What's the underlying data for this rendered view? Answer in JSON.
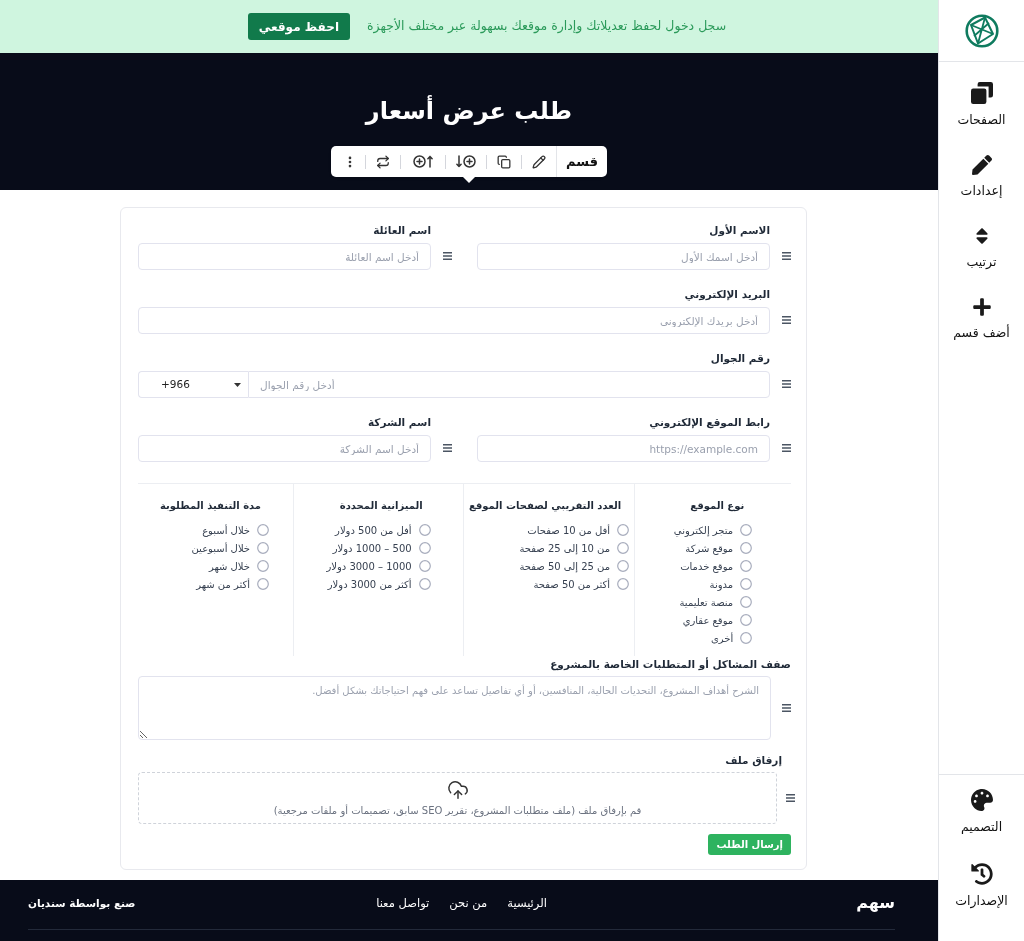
{
  "banner": {
    "message": "سجل دخول لحفظ تعديلاتك وإدارة موقعك بسهولة عبر مختلف الأجهزة",
    "button": "احفظ موقعي"
  },
  "header": {
    "title": "طلب عرض أسعار",
    "toolbar_label": "قسم"
  },
  "form": {
    "rows": [
      {
        "fields": [
          {
            "kind": "text",
            "label": "الاسم الأول",
            "placeholder": "أدخل اسمك الأول"
          },
          {
            "kind": "text",
            "label": "اسم العائلة",
            "placeholder": "أدخل اسم العائلة"
          }
        ]
      },
      {
        "fields": [
          {
            "kind": "text",
            "label": "البريد الإلكتروني",
            "placeholder": "أدخل بريدك الإلكتروني"
          }
        ]
      },
      {
        "fields": [
          {
            "kind": "phone",
            "label": "رقم الجوال",
            "placeholder": "أدخل رقم الجوال",
            "country_code": "+966"
          }
        ]
      },
      {
        "fields": [
          {
            "kind": "text",
            "label": "رابط الموقع الإلكتروني",
            "placeholder": "https://example.com"
          },
          {
            "kind": "text",
            "label": "اسم الشركة",
            "placeholder": "أدخل اسم الشركة"
          }
        ]
      }
    ],
    "choice_groups": [
      {
        "title": "نوع الموقع",
        "options": [
          {
            "label": "متجر إلكتروني",
            "selected": false
          },
          {
            "label": "موقع شركة",
            "selected": false
          },
          {
            "label": "موقع خدمات",
            "selected": false
          },
          {
            "label": "مدونة",
            "selected": false
          },
          {
            "label": "منصة تعليمية",
            "selected": false
          },
          {
            "label": "موقع عقاري",
            "selected": false
          },
          {
            "label": "أخرى",
            "selected": false
          }
        ]
      },
      {
        "title": "العدد التقريبي لصفحات الموقع",
        "options": [
          {
            "label": "أفل من 10 صفحات",
            "selected": false
          },
          {
            "label": "من 10 إلى 25 صفحة",
            "selected": false
          },
          {
            "label": "من 25 إلى 50 صفحة",
            "selected": false
          },
          {
            "label": "أكثر من 50 صفحة",
            "selected": false
          }
        ]
      },
      {
        "title": "الميزانية المحددة",
        "options": [
          {
            "label": "أفل من 500 دولار",
            "selected": false
          },
          {
            "label": "500 – 1000 دولار",
            "selected": false
          },
          {
            "label": "1000 – 3000 دولار",
            "selected": false
          },
          {
            "label": "أكثر من 3000 دولار",
            "selected": false
          }
        ]
      },
      {
        "title": "مدة التنفيذ المطلوبة",
        "options": [
          {
            "label": "خلال أسبوع",
            "selected": false
          },
          {
            "label": "خلال أسبوعين",
            "selected": false
          },
          {
            "label": "خلال شهر",
            "selected": false
          },
          {
            "label": "أكثر من شهر",
            "selected": false
          }
        ]
      }
    ],
    "description": {
      "label": "صفف المشاكل أو المتطلبات الخاصة بالمشروع",
      "placeholder": "الشرح أهداف المشروع، التحديات الحالية، المنافسين، أو أي تفاصيل تساعد على فهم احتياجاتك بشكل أفضل."
    },
    "attachment": {
      "label": "إرفاق ملف",
      "hint": "قم بإرفاق ملف (ملف متطلبات المشروع، تقرير SEO سابق، تصميمات أو ملفات مرجعية)"
    },
    "submit": "إرسال الطلب"
  },
  "footer": {
    "brand": "سهم",
    "links": [
      "الرئيسية",
      "من نحن",
      "تواصل معنا"
    ],
    "credit": "صنع بواسطة سنديان"
  },
  "sidebar": {
    "top_items": [
      {
        "label": "الصفحات"
      },
      {
        "label": "إعدادات"
      },
      {
        "label": "ترتيب"
      },
      {
        "label": "أضف قسم"
      }
    ],
    "bottom_items": [
      {
        "label": "التصميم"
      },
      {
        "label": "الإصدارات"
      }
    ]
  }
}
